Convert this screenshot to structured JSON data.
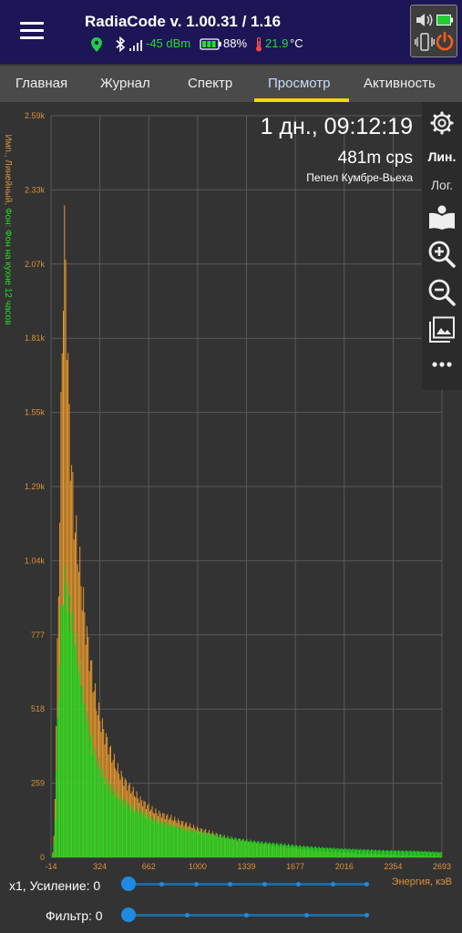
{
  "header": {
    "title": "RadiaCode v. 1.00.31 / 1.16",
    "signal": "-45 dBm",
    "battery": "88%",
    "temperature": "21.9",
    "temp_unit": "°C"
  },
  "tabs": [
    {
      "label": "Главная"
    },
    {
      "label": "Журнал"
    },
    {
      "label": "Спектр"
    },
    {
      "label": "Просмотр",
      "active": true
    },
    {
      "label": "Активность"
    }
  ],
  "spectrum": {
    "time": "1 дн., 09:12:19",
    "rate": "481m cps",
    "sample": "Пепел Кумбре-Вьеха",
    "y_axis_prefix": "Имп., Линейный, ",
    "y_axis_background": "Фон: Фон на кухне 12 часов",
    "energy_label": "Энергия, кэВ"
  },
  "toolbar": {
    "lin": "Лин.",
    "log": "Лог."
  },
  "controls": {
    "gain": "x1, Усиление: 0",
    "filter": "Фильтр: 0"
  },
  "chart_data": {
    "type": "bar",
    "scale": "linear",
    "xlabel": "Энергия, кэВ",
    "ylabel": "Имп., Линейный",
    "x_ticks": [
      "-14",
      "324",
      "662",
      "1000",
      "1339",
      "1677",
      "2016",
      "2354",
      "2693"
    ],
    "y_ticks": [
      "0",
      "259",
      "518",
      "777",
      "1.04k",
      "1.29k",
      "1.55k",
      "1.81k",
      "2.07k",
      "2.33k",
      "2.59k"
    ],
    "xlim": [
      -14,
      2693
    ],
    "ylim": [
      0,
      2590
    ],
    "grid": true,
    "series": [
      {
        "name": "Пепел Кумбре-Вьеха",
        "color": "#e8982e",
        "x": [
          -14,
          0,
          10,
          20,
          30,
          40,
          50,
          60,
          70,
          80,
          90,
          100,
          110,
          120,
          130,
          140,
          150,
          160,
          180,
          200,
          225,
          250,
          275,
          300,
          330,
          360,
          400,
          450,
          500,
          550,
          600,
          650,
          700,
          800,
          900,
          1000,
          1100,
          1200,
          1300,
          1400,
          1500,
          1600,
          1700,
          1800,
          1900,
          2000,
          2100,
          2200,
          2300,
          2400,
          2500,
          2600,
          2693
        ],
        "values": [
          0,
          30,
          200,
          500,
          800,
          1100,
          1450,
          1800,
          2100,
          2150,
          1950,
          1700,
          1500,
          1400,
          1300,
          1200,
          1150,
          1100,
          1020,
          920,
          800,
          700,
          610,
          530,
          470,
          420,
          360,
          300,
          260,
          230,
          200,
          180,
          160,
          140,
          120,
          100,
          85,
          70,
          60,
          50,
          42,
          35,
          30,
          25,
          20,
          17,
          14,
          12,
          10,
          8,
          6,
          5,
          4
        ]
      },
      {
        "name": "Фон: Фон на кухне 12 часов",
        "color": "#22dd22",
        "x": [
          -14,
          0,
          10,
          20,
          30,
          40,
          50,
          60,
          70,
          80,
          90,
          100,
          110,
          120,
          130,
          140,
          150,
          160,
          180,
          200,
          225,
          250,
          275,
          300,
          330,
          360,
          400,
          450,
          500,
          550,
          600,
          650,
          700,
          800,
          900,
          1000,
          1100,
          1200,
          1300,
          1400,
          1500,
          1600,
          1700,
          1800,
          1900,
          2000,
          2100,
          2200,
          2300,
          2400,
          2500,
          2600,
          2693
        ],
        "values": [
          0,
          20,
          130,
          330,
          500,
          650,
          800,
          900,
          950,
          960,
          940,
          900,
          880,
          850,
          820,
          790,
          760,
          720,
          650,
          580,
          500,
          440,
          380,
          340,
          300,
          270,
          240,
          210,
          190,
          170,
          160,
          145,
          130,
          115,
          100,
          90,
          80,
          70,
          62,
          55,
          50,
          45,
          40,
          36,
          33,
          30,
          28,
          26,
          24,
          23,
          22,
          20,
          18
        ]
      }
    ]
  }
}
